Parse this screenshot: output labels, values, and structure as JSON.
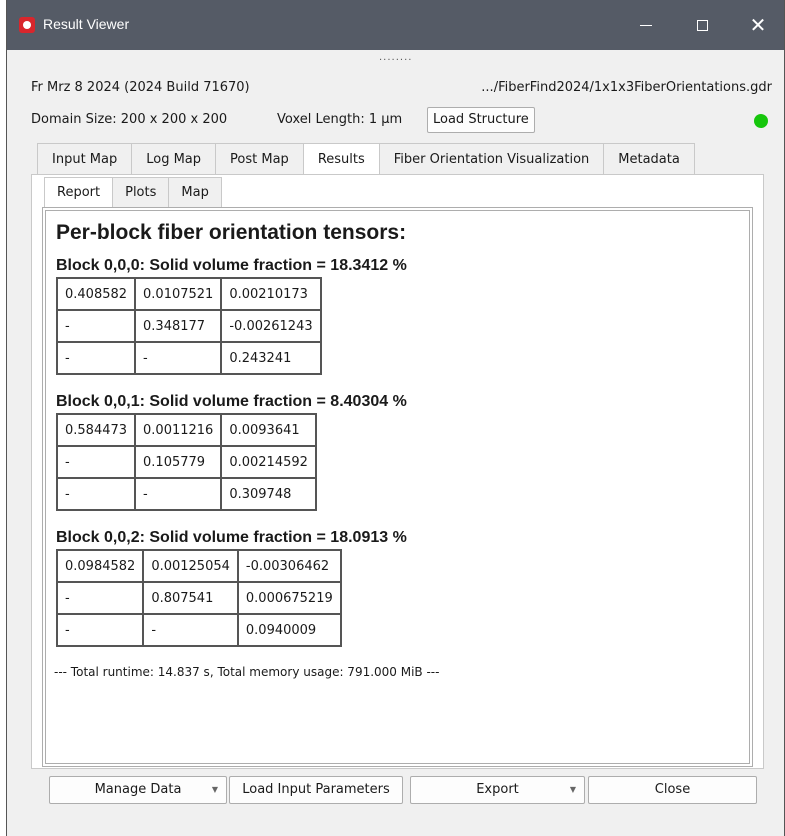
{
  "window": {
    "title": "Result Viewer",
    "app_icon": "app-logo-icon",
    "controls": {
      "minimize": "minimize-icon",
      "maximize": "maximize-icon",
      "close": "close-icon"
    }
  },
  "splitter": "........",
  "info": {
    "build": "Fr Mrz 8 2024 (2024 Build 71670)",
    "file_path": ".../FiberFind2024/1x1x3FiberOrientations.gdr",
    "domain_size": "Domain Size: 200 x 200 x 200",
    "voxel_length": "Voxel Length: 1 µm",
    "load_structure_label": "Load Structure",
    "status_color": "#16c60c"
  },
  "tabs": [
    {
      "label": "Input Map"
    },
    {
      "label": "Log Map"
    },
    {
      "label": "Post Map"
    },
    {
      "label": "Results"
    },
    {
      "label": "Fiber Orientation Visualization"
    },
    {
      "label": "Metadata"
    }
  ],
  "subtabs": [
    {
      "label": "Report"
    },
    {
      "label": "Plots"
    },
    {
      "label": "Map"
    }
  ],
  "report": {
    "heading": "Per-block fiber orientation tensors:",
    "blocks": [
      {
        "title": "Block 0,0,0: Solid volume fraction = 18.3412 %",
        "rows": [
          [
            "0.408582",
            "0.0107521",
            "0.00210173"
          ],
          [
            "-",
            "0.348177",
            "-0.00261243"
          ],
          [
            "-",
            "-",
            "0.243241"
          ]
        ]
      },
      {
        "title": "Block 0,0,1: Solid volume fraction = 8.40304 %",
        "rows": [
          [
            "0.584473",
            "0.0011216",
            "0.0093641"
          ],
          [
            "-",
            "0.105779",
            "0.00214592"
          ],
          [
            "-",
            "-",
            "0.309748"
          ]
        ]
      },
      {
        "title": "Block 0,0,2: Solid volume fraction = 18.0913 %",
        "rows": [
          [
            "0.0984582",
            "0.00125054",
            "-0.00306462"
          ],
          [
            "-",
            "0.807541",
            "0.000675219"
          ],
          [
            "-",
            "-",
            "0.0940009"
          ]
        ]
      }
    ],
    "runtime": "--- Total runtime: 14.837 s, Total memory usage: 791.000 MiB ---"
  },
  "buttons": {
    "manage_data": "Manage Data",
    "load_input_parameters": "Load Input Parameters",
    "export": "Export",
    "close": "Close"
  }
}
